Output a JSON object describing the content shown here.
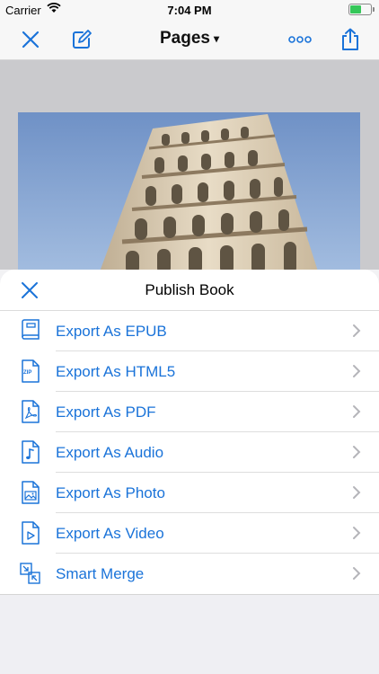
{
  "status": {
    "carrier": "Carrier",
    "time": "7:04 PM"
  },
  "nav": {
    "title": "Pages",
    "caret": "▾"
  },
  "sheet": {
    "title": "Publish Book",
    "items": [
      {
        "label": "Export As EPUB",
        "icon": "book-icon"
      },
      {
        "label": "Export As HTML5",
        "icon": "zip-file-icon",
        "badge": "ZIP"
      },
      {
        "label": "Export As PDF",
        "icon": "pdf-file-icon"
      },
      {
        "label": "Export As Audio",
        "icon": "audio-file-icon"
      },
      {
        "label": "Export As Photo",
        "icon": "photo-file-icon"
      },
      {
        "label": "Export As Video",
        "icon": "video-file-icon"
      },
      {
        "label": "Smart Merge",
        "icon": "merge-icon"
      }
    ]
  },
  "colors": {
    "accent": "#1a73d9"
  }
}
